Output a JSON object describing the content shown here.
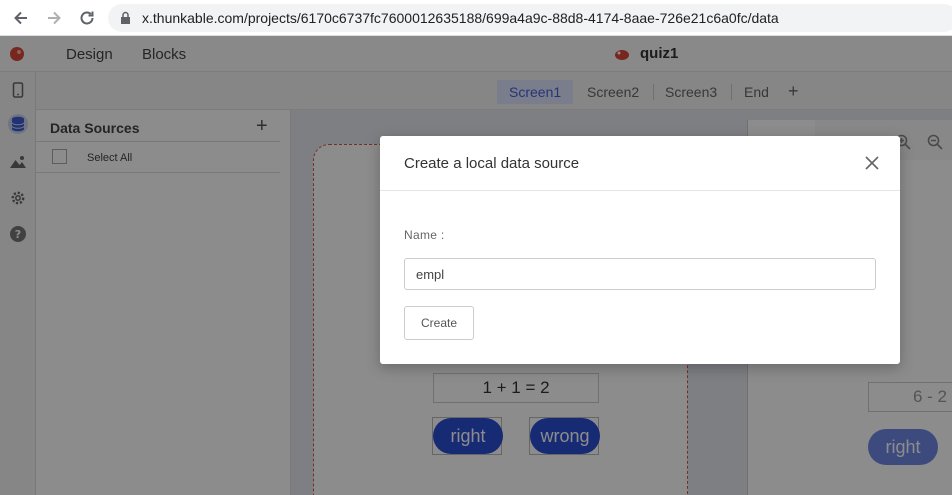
{
  "browser": {
    "url": "x.thunkable.com/projects/6170c6737fc7600012635188/699a4a9c-88d8-4174-8aae-726e21c6a0fc/data"
  },
  "header": {
    "nav": [
      "Design",
      "Blocks"
    ],
    "project_name": "quiz1"
  },
  "screen_tabs": [
    "Screen1",
    "Screen2",
    "Screen3",
    "End"
  ],
  "screen_tabs_active": "Screen1",
  "add_screen": "+",
  "data_panel": {
    "title": "Data Sources",
    "add": "+",
    "select_all": "Select All"
  },
  "canvas": {
    "screen1": {
      "equation": "1 + 1 = 2",
      "buttons": [
        "right",
        "wrong"
      ]
    },
    "screen2": {
      "equation": "6 - 2",
      "button": "right"
    }
  },
  "modal": {
    "title": "Create a local data source",
    "name_label": "Name :",
    "name_value": "empl",
    "create_button": "Create"
  },
  "colors": {
    "accent": "#2b4fd6",
    "active_tab_bg": "#dfe6ff",
    "active_tab_text": "#4a5dd6",
    "error_border": "#d9534f"
  },
  "icons": [
    "back-arrow-icon",
    "forward-arrow-icon",
    "reload-icon",
    "lock-icon",
    "thunkable-logo-icon",
    "phone-icon",
    "database-icon",
    "image-icon",
    "gear-icon",
    "help-icon",
    "zoom-in-icon",
    "zoom-out-icon",
    "close-icon"
  ]
}
